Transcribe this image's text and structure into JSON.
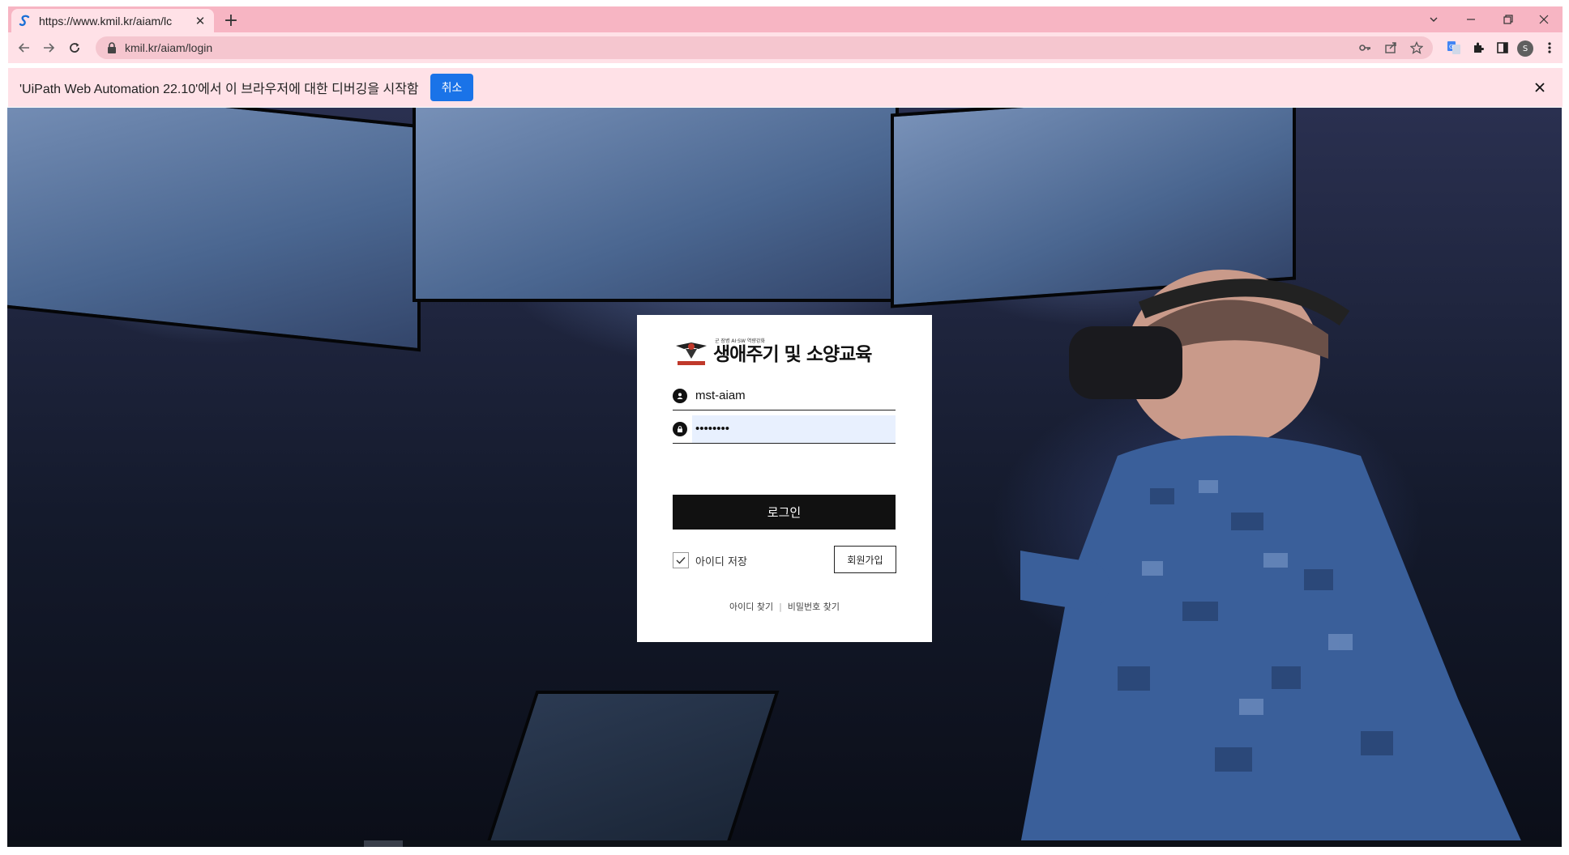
{
  "browser": {
    "tab_title": "https://www.kmil.kr/aiam/lc",
    "tab_close": "✕",
    "new_tab": "+",
    "url": "kmil.kr/aiam/login",
    "profile_initial": "S",
    "accent_color": "#f7b5c3"
  },
  "infobar": {
    "message": "'UiPath Web Automation 22.10'에서 이 브라우저에 대한 디버깅을 시작함",
    "cancel_label": "취소",
    "button_color": "#1a73e8"
  },
  "login": {
    "logo_subtitle": "군 장병 AI·SW 역량강화",
    "logo_title": "생애주기 및 소양교육",
    "username_value": "mst-aiam",
    "password_value": "••••••••",
    "login_label": "로그인",
    "remember_label": "아이디 저장",
    "remember_checked": true,
    "join_label": "회원가입",
    "find_id_label": "아이디 찾기",
    "find_pw_label": "비밀번호 찾기",
    "separator": "|"
  }
}
